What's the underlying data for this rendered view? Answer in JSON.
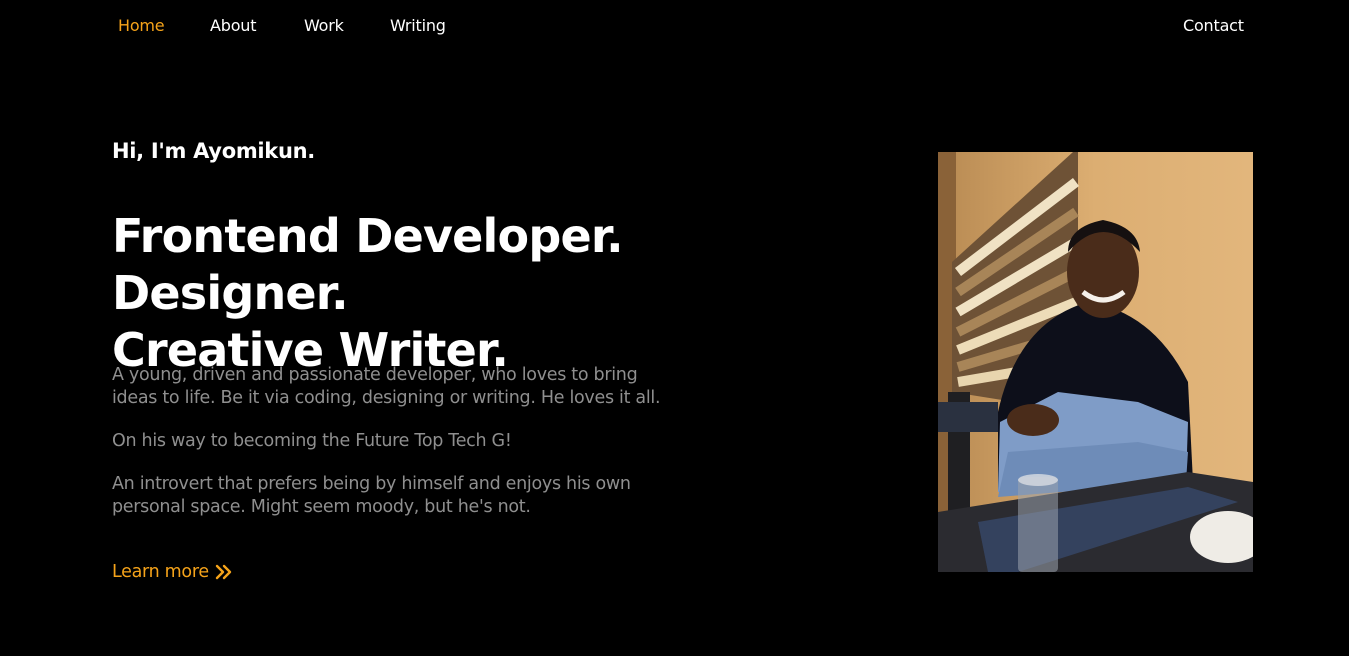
{
  "nav": {
    "items": [
      {
        "label": "Home",
        "active": true
      },
      {
        "label": "About",
        "active": false
      },
      {
        "label": "Work",
        "active": false
      },
      {
        "label": "Writing",
        "active": false
      }
    ],
    "contact_label": "Contact"
  },
  "hero": {
    "greeting": "Hi, I'm Ayomikun.",
    "headline_line1": "Frontend Developer. Designer.",
    "headline_line2": "Creative Writer.",
    "bio": [
      "A young, driven and passionate developer, who loves to bring ideas to life. Be it via coding, designing or writing. He loves it all.",
      "On his way to becoming the Future Top Tech G!",
      "An introvert that prefers being by himself and enjoys his own personal space. Might seem moody, but he's not."
    ],
    "learn_more": "Learn more",
    "learn_more_icon": "double-chevron-right-icon",
    "photo": "portrait-photo"
  },
  "colors": {
    "background": "#000000",
    "accent": "#f5a31a",
    "text": "#ffffff",
    "muted": "#8f8f8f"
  }
}
